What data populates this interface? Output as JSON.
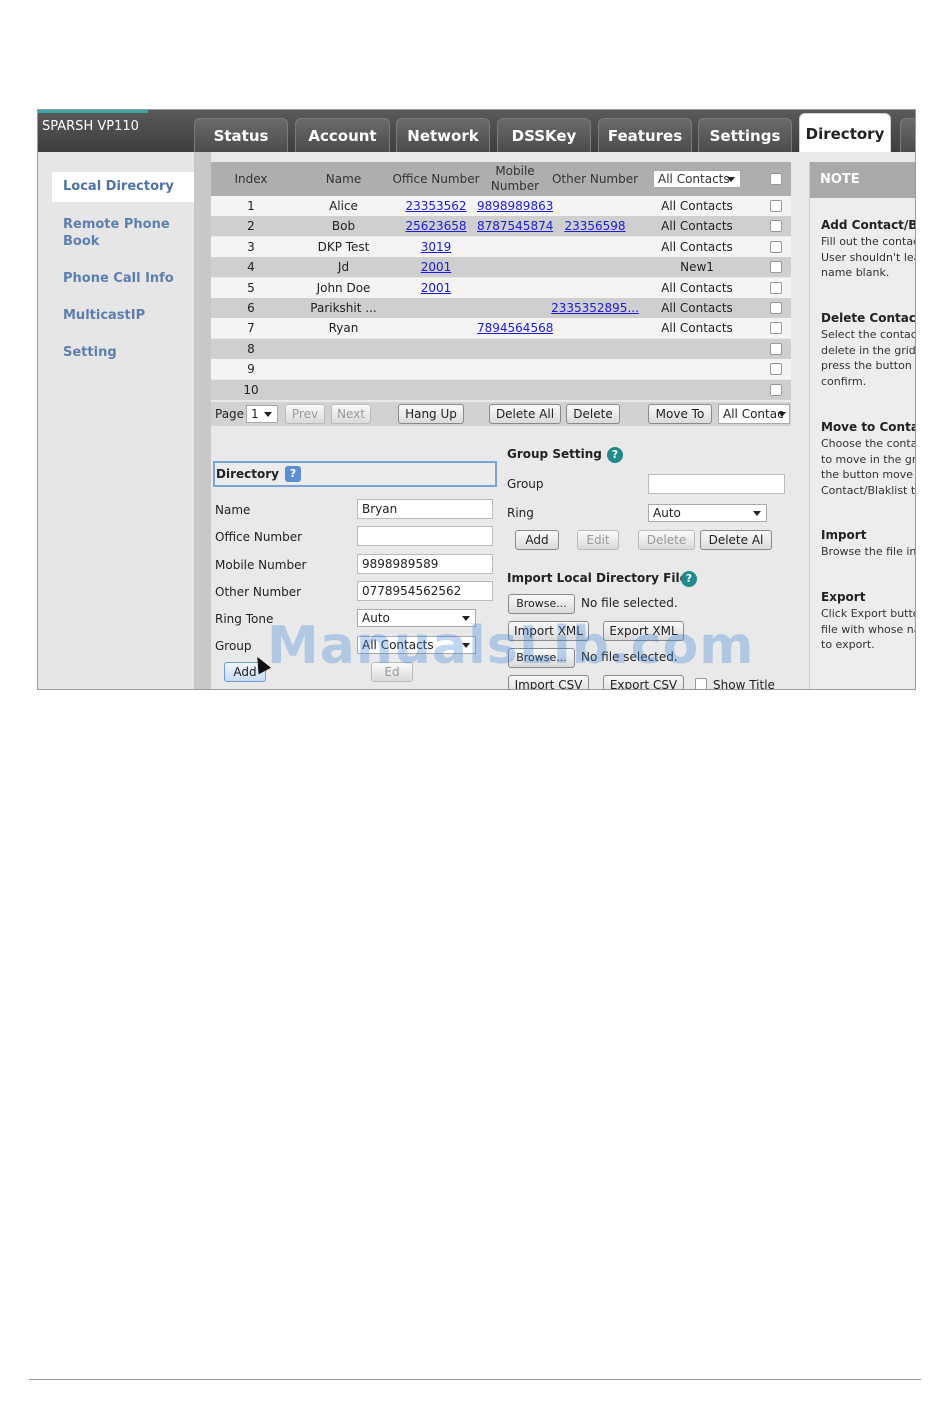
{
  "header": {
    "model": "SPARSH VP110",
    "tabs": [
      {
        "label": "Status"
      },
      {
        "label": "Account"
      },
      {
        "label": "Network"
      },
      {
        "label": "DSSKey"
      },
      {
        "label": "Features"
      },
      {
        "label": "Settings"
      },
      {
        "label": "Directory",
        "active": true
      }
    ]
  },
  "sidebar": {
    "items": [
      {
        "label": "Local Directory",
        "active": true
      },
      {
        "label": "Remote Phone Book"
      },
      {
        "label": "Phone Call Info"
      },
      {
        "label": "MulticastIP"
      },
      {
        "label": "Setting"
      }
    ]
  },
  "contacts": {
    "columns": [
      "Index",
      "Name",
      "Office Number",
      "Mobile Number",
      "Other Number"
    ],
    "filter": "All Contacts",
    "rows": [
      {
        "index": "1",
        "name": "Alice",
        "office": "23353562",
        "mobile": "9898989863",
        "other": "",
        "group": "All Contacts"
      },
      {
        "index": "2",
        "name": "Bob",
        "office": "25623658",
        "mobile": "8787545874",
        "other": "23356598",
        "group": "All Contacts"
      },
      {
        "index": "3",
        "name": "DKP Test",
        "office": "3019",
        "mobile": "",
        "other": "",
        "group": "All Contacts"
      },
      {
        "index": "4",
        "name": "Jd",
        "office": "2001",
        "mobile": "",
        "other": "",
        "group": "New1"
      },
      {
        "index": "5",
        "name": "John Doe",
        "office": "2001",
        "mobile": "",
        "other": "",
        "group": "All Contacts"
      },
      {
        "index": "6",
        "name": "Parikshit ...",
        "office": "",
        "mobile": "",
        "other": "2335352895...",
        "group": "All Contacts"
      },
      {
        "index": "7",
        "name": "Ryan",
        "office": "",
        "mobile": "7894564568",
        "other": "",
        "group": "All Contacts"
      },
      {
        "index": "8",
        "name": "",
        "office": "",
        "mobile": "",
        "other": "",
        "group": ""
      },
      {
        "index": "9",
        "name": "",
        "office": "",
        "mobile": "",
        "other": "",
        "group": ""
      },
      {
        "index": "10",
        "name": "",
        "office": "",
        "mobile": "",
        "other": "",
        "group": ""
      }
    ]
  },
  "pager": {
    "page_label": "Page",
    "page": "1",
    "prev": "Prev",
    "next": "Next",
    "hang_up": "Hang Up",
    "delete_all": "Delete All",
    "delete": "Delete",
    "move_to": "Move To",
    "move_target": "All Contac"
  },
  "directory_form": {
    "title": "Directory",
    "name_label": "Name",
    "name_value": "Bryan",
    "office_label": "Office Number",
    "office_value": "",
    "mobile_label": "Mobile Number",
    "mobile_value": "9898989589",
    "other_label": "Other Number",
    "other_value": "0778954562562",
    "ringtone_label": "Ring Tone",
    "ringtone_value": "Auto",
    "group_label": "Group",
    "group_value": "All Contacts",
    "add_button": "Add",
    "edit_button": "Ed"
  },
  "group_setting": {
    "title": "Group Setting",
    "group_label": "Group",
    "group_value": "",
    "ring_label": "Ring",
    "ring_value": "Auto",
    "add": "Add",
    "edit": "Edit",
    "delete": "Delete",
    "delete_all": "Delete Al"
  },
  "import_section": {
    "title": "Import Local Directory File",
    "browse": "Browse...",
    "no_file": "No file selected.",
    "import_xml": "Import XML",
    "export_xml": "Export XML",
    "browse2": "Browse...",
    "no_file2": "No file selected.",
    "import_csv": "Import CSV",
    "export_csv": "Export CSV",
    "show_title": "Show Title"
  },
  "note": {
    "heading": "NOTE",
    "sections": [
      {
        "title": "Add Contact/Bla",
        "lines": [
          "Fill out the contac",
          "User shouldn't lea",
          "name blank."
        ]
      },
      {
        "title": "Delete Contact/",
        "lines": [
          "Select the contac",
          "delete in the grid,",
          "press the button",
          "confirm."
        ]
      },
      {
        "title": "Move to Contac",
        "lines": [
          "Choose the conta",
          "to move in the gr",
          "the button move",
          "Contact/Blaklist to"
        ]
      },
      {
        "title": "Import",
        "lines": [
          "Browse the file in"
        ]
      },
      {
        "title": "Export",
        "lines": [
          "Click Export butto",
          "file with whose na",
          "to export."
        ]
      }
    ]
  },
  "watermark": "ManualsLib.com",
  "colors": {
    "link": "#1a1ae0",
    "nav": "#5d7fb0",
    "header_dark": "#4a4a4a",
    "help_teal": "#1e8a8d"
  }
}
